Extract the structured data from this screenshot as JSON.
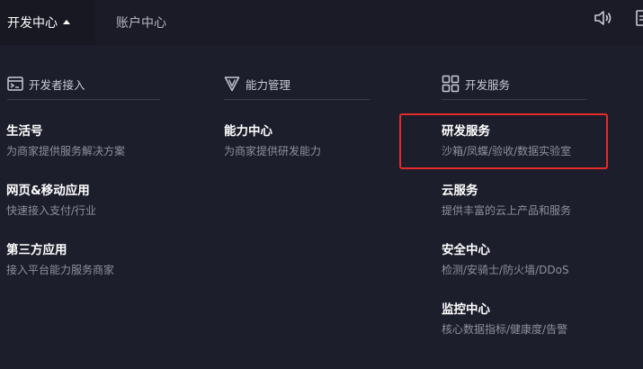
{
  "topbar": {
    "active_tab": "开发中心",
    "account_tab": "账户中心"
  },
  "icons": {
    "sound": "sound-icon",
    "developer_access": "terminal-window-icon",
    "capability_mgmt": "triangle-logo-icon",
    "dev_services": "grid-icon"
  },
  "columns": [
    {
      "heading": "开发者接入",
      "items": [
        {
          "title": "生活号",
          "desc": "为商家提供服务解决方案"
        },
        {
          "title": "网页&移动应用",
          "desc": "快速接入支付/行业"
        },
        {
          "title": "第三方应用",
          "desc": "接入平台能力服务商家"
        }
      ]
    },
    {
      "heading": "能力管理",
      "items": [
        {
          "title": "能力中心",
          "desc": "为商家提供研发能力"
        }
      ]
    },
    {
      "heading": "开发服务",
      "items": [
        {
          "title": "研发服务",
          "desc": "沙箱/凤蝶/验收/数据实验室"
        },
        {
          "title": "云服务",
          "desc": "提供丰富的云上产品和服务"
        },
        {
          "title": "安全中心",
          "desc": "检测/安骑士/防火墙/DDoS"
        },
        {
          "title": "监控中心",
          "desc": "核心数据指标/健康度/告警"
        }
      ]
    }
  ],
  "colors": {
    "background": "#1d1e2c",
    "highlight_border": "#e52a2a"
  }
}
